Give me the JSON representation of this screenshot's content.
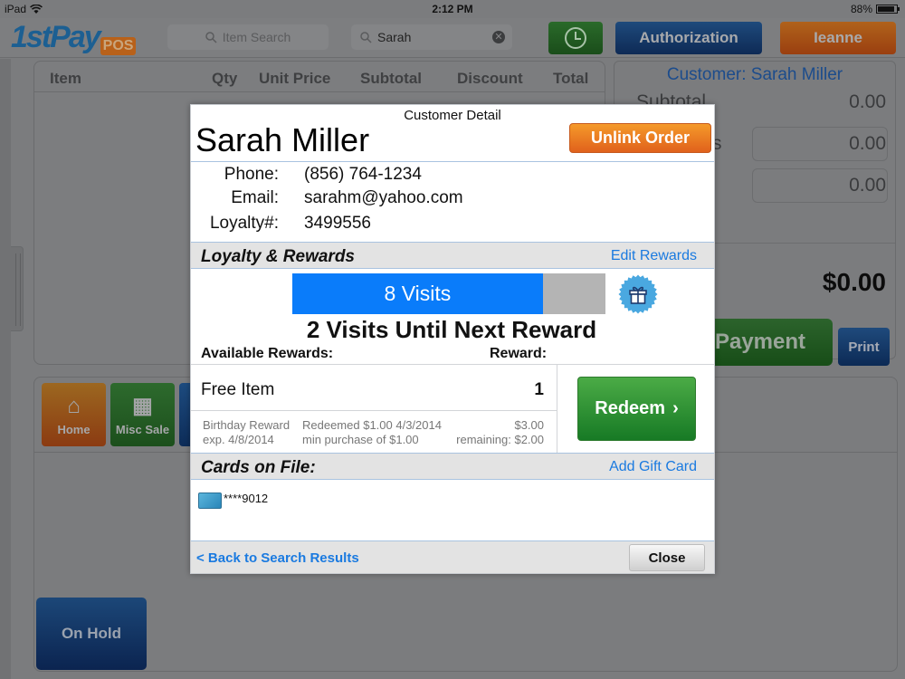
{
  "status_bar": {
    "device": "iPad",
    "time": "2:12 PM",
    "battery": "88%",
    "battery_level": 0.88
  },
  "header": {
    "logo_main": "1stPay",
    "logo_badge": "POS",
    "item_search_placeholder": "Item Search",
    "customer_search_value": "Sarah",
    "clock_icon": "clock-icon",
    "authorization_label": "Authorization",
    "user_label": "Ieanne"
  },
  "order_table": {
    "columns": [
      "Item",
      "Qty",
      "Unit Price",
      "Subtotal",
      "Discount",
      "Total"
    ],
    "rows": []
  },
  "summary": {
    "customer_label": "Customer: Sarah Miller",
    "subtotal_label": "Subtotal",
    "subtotal_value": "0.00",
    "discounts_label_fragment": "s",
    "discount_value": "0.00",
    "tax_value": "0.00",
    "grand_total": "$0.00",
    "payment_label": "Payment",
    "print_label": "Print"
  },
  "categories": {
    "tiles": [
      {
        "label": "Home",
        "icon": "home-icon"
      },
      {
        "label": "Misc Sale",
        "icon": "calculator-icon"
      }
    ],
    "on_hold_label": "On Hold"
  },
  "modal": {
    "title": "Customer Detail",
    "customer_name": "Sarah Miller",
    "unlink_label": "Unlink Order",
    "info": [
      {
        "label": "Phone:",
        "value": "(856) 764-1234"
      },
      {
        "label": "Email:",
        "value": "sarahm@yahoo.com"
      },
      {
        "label": "Loyalty#:",
        "value": "3499556"
      }
    ],
    "loyalty": {
      "section_title": "Loyalty & Rewards",
      "edit_link": "Edit Rewards",
      "visits_label": "8 Visits",
      "visits": 8,
      "visits_required": 10,
      "progress_fraction": 0.8,
      "until_next": "2 Visits Until Next Reward",
      "available_header": "Available Rewards:",
      "reward_header": "Reward:",
      "rewards": [
        {
          "name": "Free Item",
          "qty": "1",
          "type": "Birthday Reward",
          "expires": "exp. 4/8/2014",
          "redeemed": "Redeemed $1.00 4/3/2014",
          "min_purchase": "min purchase of $1.00",
          "amount": "$3.00",
          "remaining": "remaining: $2.00"
        }
      ],
      "redeem_label": "Redeem",
      "redeem_chevron": "›"
    },
    "cards": {
      "section_title": "Cards on File:",
      "add_link": "Add Gift Card",
      "items": [
        {
          "masked": "****9012",
          "icon": "credit-card-icon"
        }
      ]
    },
    "footer": {
      "back_label": "< Back to Search Results",
      "close_label": "Close"
    }
  }
}
